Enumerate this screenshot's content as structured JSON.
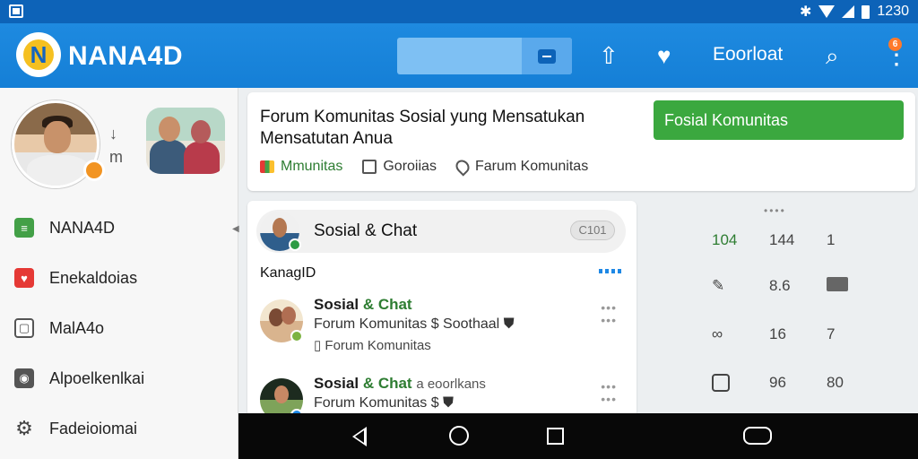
{
  "status_bar": {
    "time": "1230"
  },
  "app_bar": {
    "brand": "NANA4D",
    "logo_letter": "N",
    "label": "Eoorloat",
    "notification_count": "6",
    "icons": [
      "upload-icon",
      "heart-icon",
      "search-icon",
      "more-icon"
    ]
  },
  "sidebar": {
    "mini": {
      "arrow": "↓",
      "glyph": "m"
    },
    "items": [
      {
        "label": "NANA4D",
        "icon": "list-icon",
        "color": "#43a047"
      },
      {
        "label": "Enekaldoias",
        "icon": "chat-icon",
        "color": "#e53935"
      },
      {
        "label": "MalA4o",
        "icon": "window-icon",
        "color": "#555555"
      },
      {
        "label": "Alpoelkenlkai",
        "icon": "camera-icon",
        "color": "#555555"
      },
      {
        "label": "Fadeioiomai",
        "icon": "gear-icon",
        "color": "#444444"
      }
    ]
  },
  "header": {
    "title": "Forum Komunitas Sosial yung Mensatukan Mensatutan Anua",
    "button": "Fosial Komunitas",
    "chips": [
      "Mmunitas",
      "Goroiias",
      "Farum Komunitas"
    ]
  },
  "chat": {
    "header_name": "Sosial & Chat",
    "header_pill": "C101",
    "section_label": "KanagID",
    "messages": [
      {
        "name_a": "Sosial ",
        "name_b": "& Chat",
        "extra": "",
        "line1": "Forum Komunitas $ Soothaal ⛊",
        "line2": "▯ Forum Komunitas"
      },
      {
        "name_a": "Sosial ",
        "name_b": "& Chat",
        "extra": "a eoorlkans",
        "line1": "Forum Komunitas $ ⛊",
        "line2": ""
      }
    ]
  },
  "stats": {
    "rows": [
      {
        "c0": "104",
        "c1": "144",
        "c2": "1"
      },
      {
        "c0": "",
        "c1": "8.6",
        "c2": ""
      },
      {
        "c0": "",
        "c1": "16",
        "c2": "7"
      },
      {
        "c0": "",
        "c1": "96",
        "c2": "80"
      }
    ]
  },
  "colors": {
    "accent": "#1e8ae0",
    "green": "#3ba83f",
    "status_bar": "#0d63b8"
  }
}
